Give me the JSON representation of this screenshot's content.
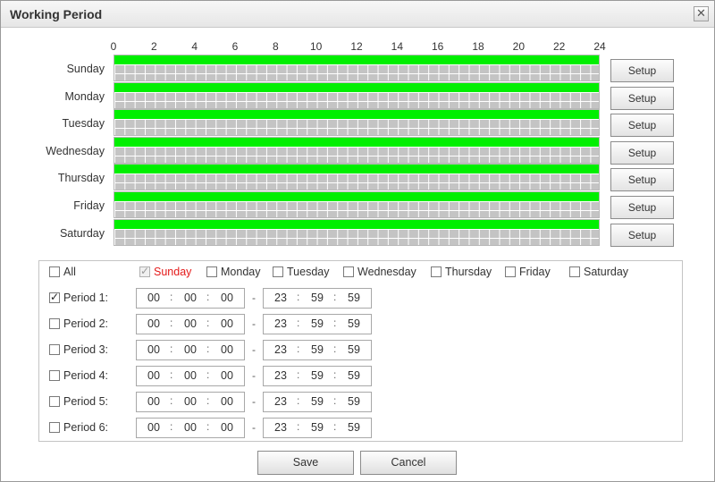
{
  "window": {
    "title": "Working Period",
    "close_symbol": "✕"
  },
  "hours": [
    "0",
    "2",
    "4",
    "6",
    "8",
    "10",
    "12",
    "14",
    "16",
    "18",
    "20",
    "22",
    "24"
  ],
  "days": [
    {
      "label": "Sunday",
      "setup": "Setup"
    },
    {
      "label": "Monday",
      "setup": "Setup"
    },
    {
      "label": "Tuesday",
      "setup": "Setup"
    },
    {
      "label": "Wednesday",
      "setup": "Setup"
    },
    {
      "label": "Thursday",
      "setup": "Setup"
    },
    {
      "label": "Friday",
      "setup": "Setup"
    },
    {
      "label": "Saturday",
      "setup": "Setup"
    }
  ],
  "schedule_color": "#00ef00",
  "day_selector": {
    "all_label": "All",
    "all_checked": false,
    "days": [
      {
        "label": "Sunday",
        "checked": true,
        "current": true
      },
      {
        "label": "Monday",
        "checked": false
      },
      {
        "label": "Tuesday",
        "checked": false
      },
      {
        "label": "Wednesday",
        "checked": false
      },
      {
        "label": "Thursday",
        "checked": false
      },
      {
        "label": "Friday",
        "checked": false
      },
      {
        "label": "Saturday",
        "checked": false
      }
    ]
  },
  "periods": [
    {
      "label": "Period 1:",
      "checked": true,
      "start": [
        "00",
        "00",
        "00"
      ],
      "end": [
        "23",
        "59",
        "59"
      ]
    },
    {
      "label": "Period 2:",
      "checked": false,
      "start": [
        "00",
        "00",
        "00"
      ],
      "end": [
        "23",
        "59",
        "59"
      ]
    },
    {
      "label": "Period 3:",
      "checked": false,
      "start": [
        "00",
        "00",
        "00"
      ],
      "end": [
        "23",
        "59",
        "59"
      ]
    },
    {
      "label": "Period 4:",
      "checked": false,
      "start": [
        "00",
        "00",
        "00"
      ],
      "end": [
        "23",
        "59",
        "59"
      ]
    },
    {
      "label": "Period 5:",
      "checked": false,
      "start": [
        "00",
        "00",
        "00"
      ],
      "end": [
        "23",
        "59",
        "59"
      ]
    },
    {
      "label": "Period 6:",
      "checked": false,
      "start": [
        "00",
        "00",
        "00"
      ],
      "end": [
        "23",
        "59",
        "59"
      ]
    }
  ],
  "time_separator": ":",
  "range_separator": "-",
  "footer": {
    "save_label": "Save",
    "cancel_label": "Cancel"
  }
}
